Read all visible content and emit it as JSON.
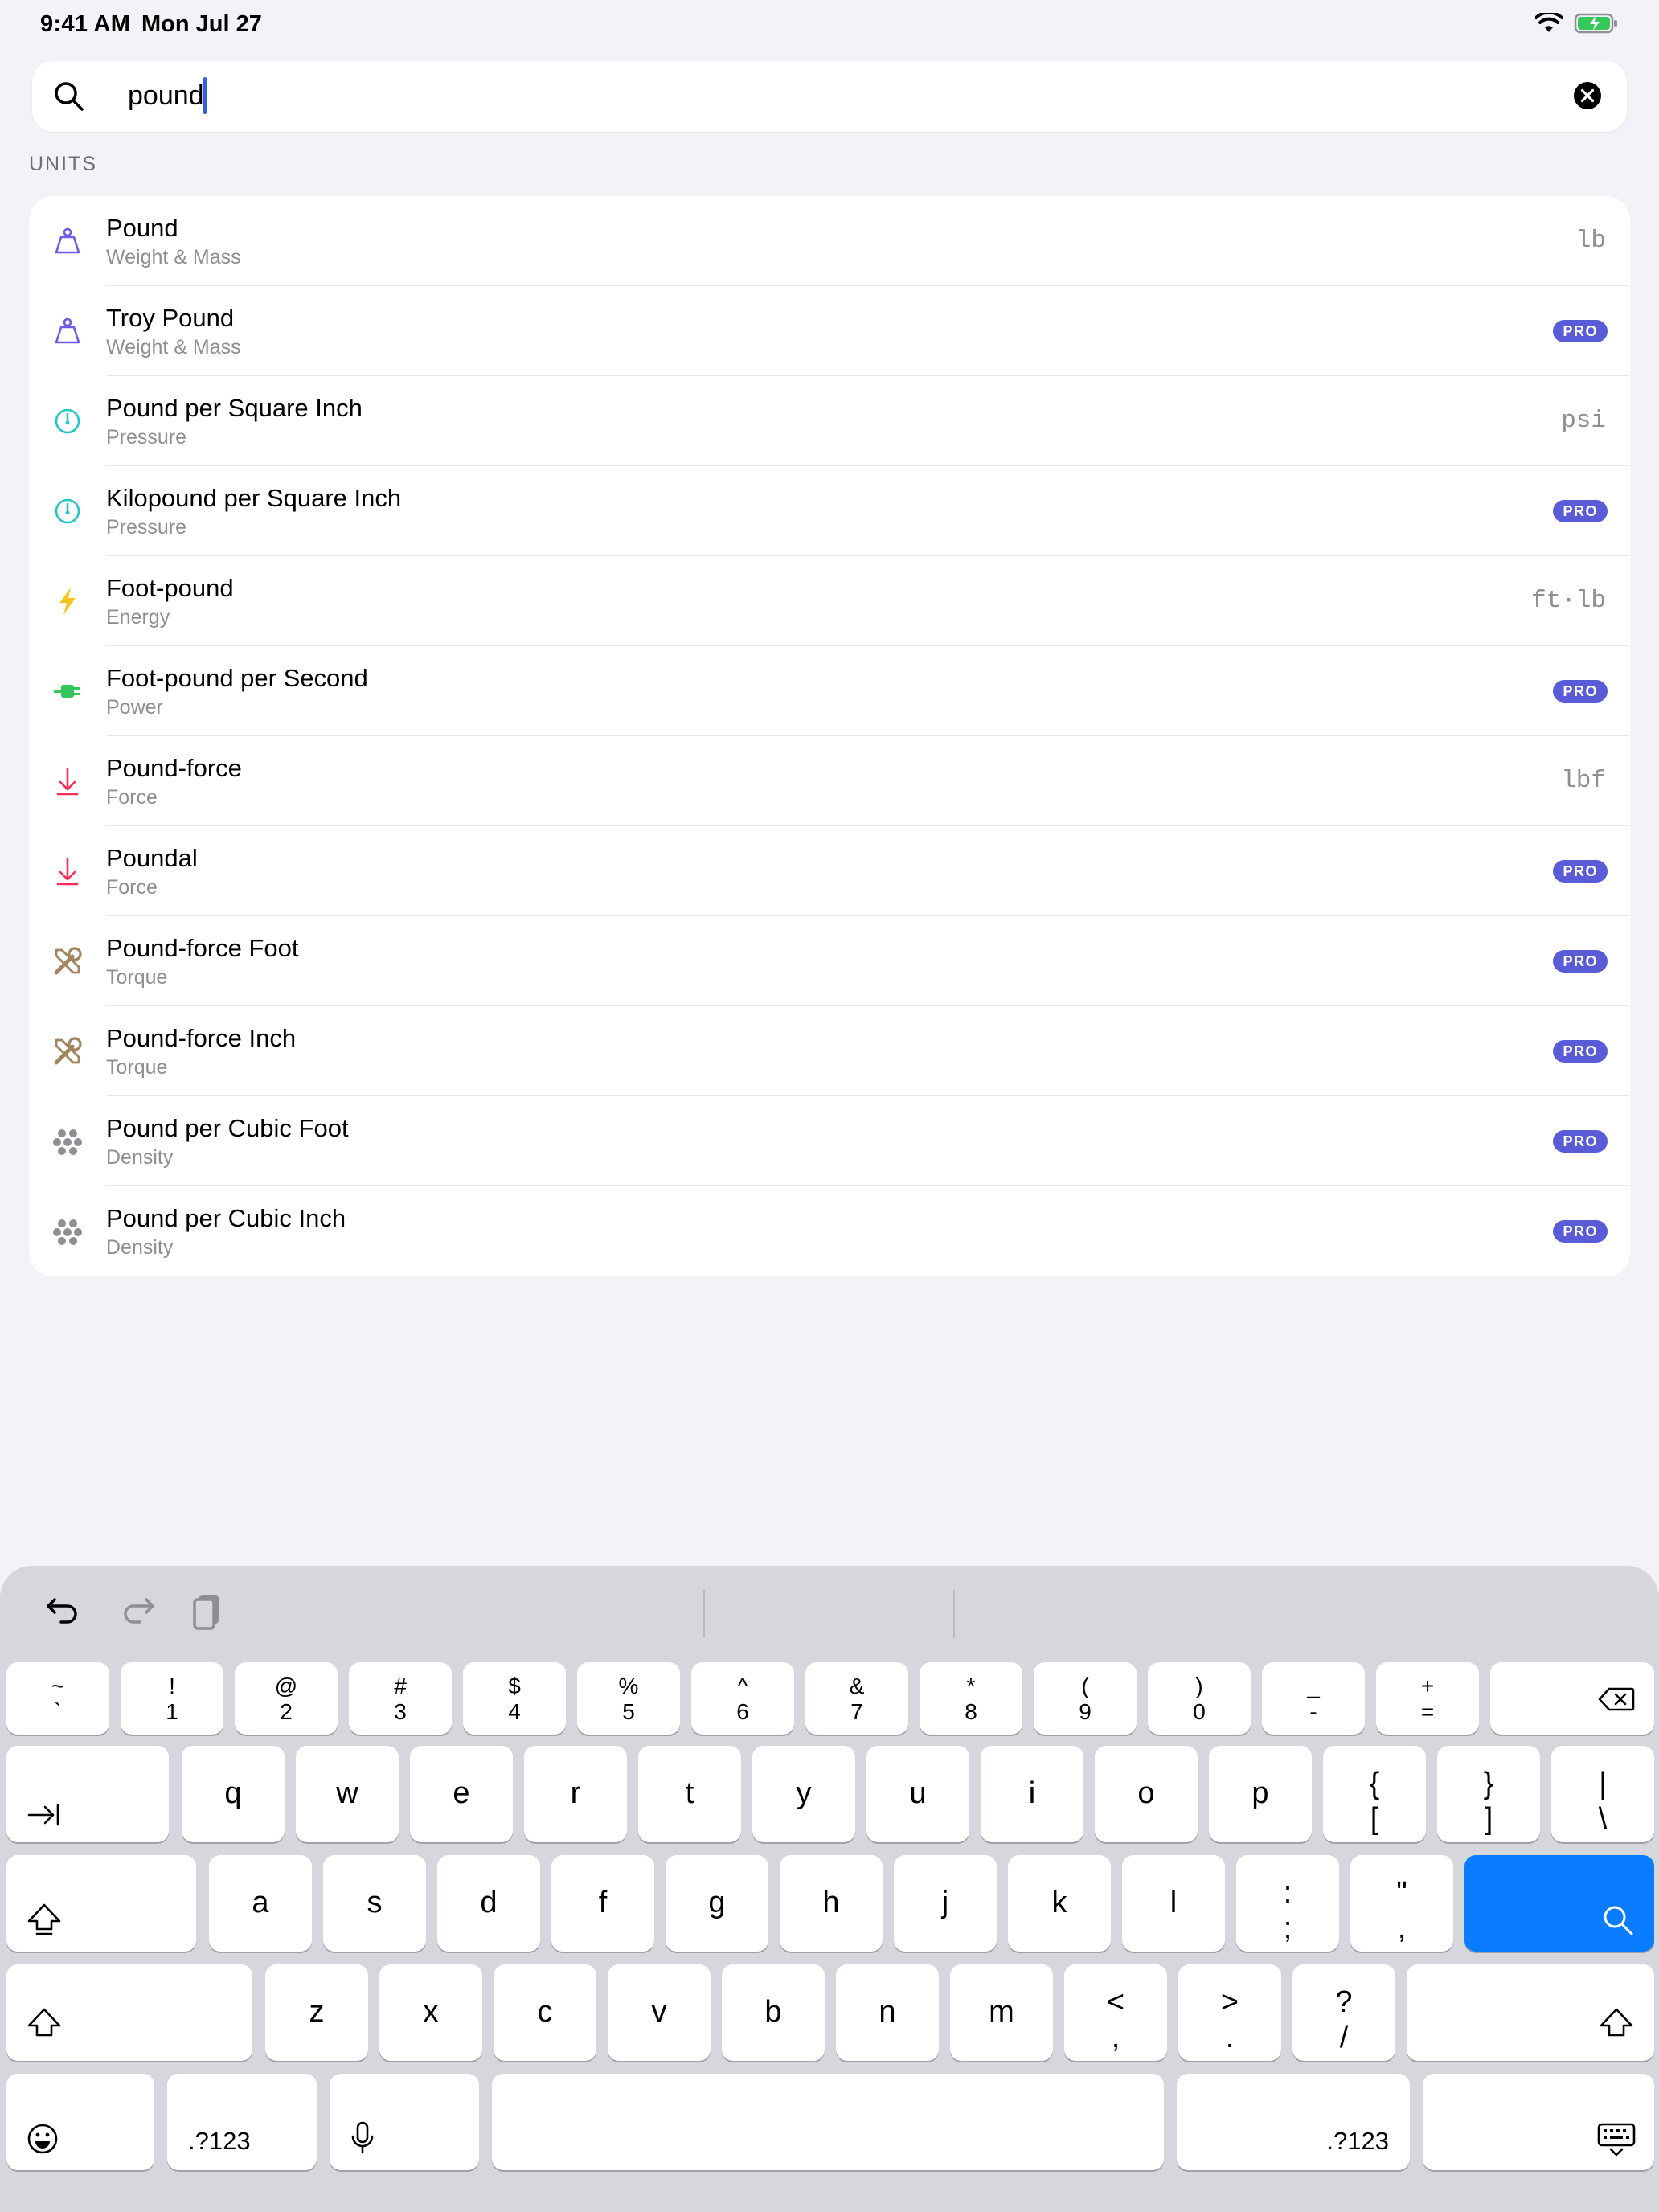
{
  "status": {
    "time": "9:41 AM",
    "date": "Mon Jul 27",
    "icons": [
      "wifi-icon",
      "battery-charging-icon"
    ]
  },
  "search": {
    "value": "pound",
    "icon": "search-icon",
    "clear_icon": "clear-icon"
  },
  "section_header": "UNITS",
  "units": [
    {
      "name": "Pound",
      "category": "Weight & Mass",
      "symbol": "lb",
      "pro": false,
      "icon": "weight-icon",
      "color": "#6c5ce7"
    },
    {
      "name": "Troy Pound",
      "category": "Weight & Mass",
      "symbol": "",
      "pro": true,
      "icon": "weight-icon",
      "color": "#6c5ce7"
    },
    {
      "name": "Pound per Square Inch",
      "category": "Pressure",
      "symbol": "psi",
      "pro": false,
      "icon": "gauge-icon",
      "color": "#1fc7c7"
    },
    {
      "name": "Kilopound per Square Inch",
      "category": "Pressure",
      "symbol": "",
      "pro": true,
      "icon": "gauge-icon",
      "color": "#1fc7c7"
    },
    {
      "name": "Foot-pound",
      "category": "Energy",
      "symbol": "ft·lb",
      "pro": false,
      "icon": "bolt-icon",
      "color": "#f7c51b"
    },
    {
      "name": "Foot-pound per Second",
      "category": "Power",
      "symbol": "",
      "pro": true,
      "icon": "plug-icon",
      "color": "#33c759"
    },
    {
      "name": "Pound-force",
      "category": "Force",
      "symbol": "lbf",
      "pro": false,
      "icon": "arrow-down-to-line-icon",
      "color": "#ff2d55"
    },
    {
      "name": "Poundal",
      "category": "Force",
      "symbol": "",
      "pro": true,
      "icon": "arrow-down-to-line-icon",
      "color": "#ff2d55"
    },
    {
      "name": "Pound-force Foot",
      "category": "Torque",
      "symbol": "",
      "pro": true,
      "icon": "wrench-screwdriver-icon",
      "color": "#a2845e"
    },
    {
      "name": "Pound-force Inch",
      "category": "Torque",
      "symbol": "",
      "pro": true,
      "icon": "wrench-screwdriver-icon",
      "color": "#a2845e"
    },
    {
      "name": "Pound per Cubic Foot",
      "category": "Density",
      "symbol": "",
      "pro": true,
      "icon": "molecules-icon",
      "color": "#8e8e93"
    },
    {
      "name": "Pound per Cubic Inch",
      "category": "Density",
      "symbol": "",
      "pro": true,
      "icon": "molecules-icon",
      "color": "#8e8e93"
    }
  ],
  "pro_label": "PRO",
  "keyboard": {
    "toolbar": [
      "undo-icon",
      "redo-icon",
      "paste-icon"
    ],
    "row1": [
      {
        "top": "~",
        "bot": "`"
      },
      {
        "top": "!",
        "bot": "1"
      },
      {
        "top": "@",
        "bot": "2"
      },
      {
        "top": "#",
        "bot": "3"
      },
      {
        "top": "$",
        "bot": "4"
      },
      {
        "top": "%",
        "bot": "5"
      },
      {
        "top": "^",
        "bot": "6"
      },
      {
        "top": "&",
        "bot": "7"
      },
      {
        "top": "*",
        "bot": "8"
      },
      {
        "top": "(",
        "bot": "9"
      },
      {
        "top": ")",
        "bot": "0"
      },
      {
        "top": "_",
        "bot": "-"
      },
      {
        "top": "+",
        "bot": "="
      }
    ],
    "row2": [
      "q",
      "w",
      "e",
      "r",
      "t",
      "y",
      "u",
      "i",
      "o",
      "p"
    ],
    "row2_extra": [
      {
        "top": "{",
        "bot": "["
      },
      {
        "top": "}",
        "bot": "]"
      },
      {
        "top": "|",
        "bot": "\\"
      }
    ],
    "row3": [
      "a",
      "s",
      "d",
      "f",
      "g",
      "h",
      "j",
      "k",
      "l"
    ],
    "row3_extra": [
      {
        "top": ":",
        "bot": ";"
      },
      {
        "top": "\"",
        "bot": ","
      }
    ],
    "row4": [
      "z",
      "x",
      "c",
      "v",
      "b",
      "n",
      "m"
    ],
    "row4_extra": [
      {
        "top": "<",
        "bot": ","
      },
      {
        "top": ">",
        "bot": "."
      },
      {
        "top": "?",
        "bot": "/"
      }
    ],
    "numbers_label": ".?123",
    "accent_color": "#0a7cff"
  }
}
